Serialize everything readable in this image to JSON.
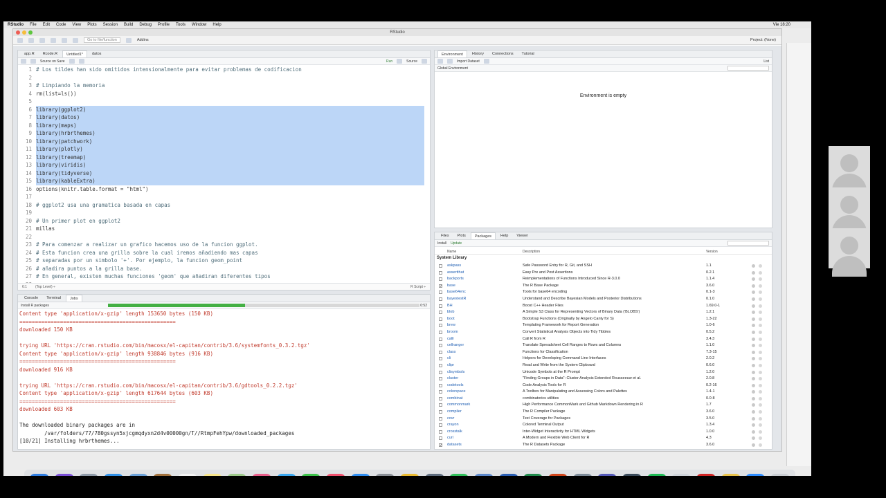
{
  "menubar": {
    "items": [
      "RStudio",
      "File",
      "Edit",
      "Code",
      "View",
      "Plots",
      "Session",
      "Build",
      "Debug",
      "Profile",
      "Tools",
      "Window",
      "Help"
    ],
    "clock": "Vie 18:20"
  },
  "window": {
    "title": "RStudio",
    "toolbar": {
      "goto_placeholder": "Go to file/function",
      "addins": "Addins",
      "project": "Project: (None)"
    }
  },
  "editor": {
    "tabs": [
      "app.R",
      "Rcode.R",
      "Untitled1*",
      "datos"
    ],
    "active_tab": "Untitled1*",
    "source_on_save": "Source on Save",
    "run": "Run",
    "source": "Source",
    "lines": [
      {
        "n": "1",
        "text": "# Los tildes han sido omitidos intensionalmente para evitar problemas de codificacion"
      },
      {
        "n": "2",
        "text": ""
      },
      {
        "n": "3",
        "text": "# Limpiando la memoria"
      },
      {
        "n": "4",
        "text": "rm(list=ls())"
      },
      {
        "n": "5",
        "text": ""
      },
      {
        "n": "6",
        "text": "library(ggplot2)"
      },
      {
        "n": "7",
        "text": "library(datos)"
      },
      {
        "n": "8",
        "text": "library(maps)"
      },
      {
        "n": "9",
        "text": "library(hrbrthemes)"
      },
      {
        "n": "10",
        "text": "library(patchwork)"
      },
      {
        "n": "11",
        "text": "library(plotly)"
      },
      {
        "n": "12",
        "text": "library(treemap)"
      },
      {
        "n": "13",
        "text": "library(viridis)"
      },
      {
        "n": "14",
        "text": "library(tidyverse)"
      },
      {
        "n": "15",
        "text": "library(kableExtra)"
      },
      {
        "n": "16",
        "text": "options(knitr.table.format = \"html\")"
      },
      {
        "n": "17",
        "text": ""
      },
      {
        "n": "18",
        "text": "# ggplot2 usa una gramatica basada en capas"
      },
      {
        "n": "19",
        "text": ""
      },
      {
        "n": "20",
        "text": "# Un primer plot en ggplot2"
      },
      {
        "n": "21",
        "text": "millas"
      },
      {
        "n": "22",
        "text": ""
      },
      {
        "n": "23",
        "text": "# Para comenzar a realizar un grafico hacemos uso de la funcion ggplot."
      },
      {
        "n": "24",
        "text": "# Esta funcion crea una grilla sobre la cual iremos añadiendo mas capas"
      },
      {
        "n": "25",
        "text": "# separadas por un simbolo '+'. Por ejemplo, la funcion geom_point"
      },
      {
        "n": "26",
        "text": "# añadira puntos a la grilla base."
      },
      {
        "n": "27",
        "text": "# En general, existen muchas funciones 'geom' que añadiran diferentes tipos"
      },
      {
        "n": "28",
        "text": ""
      }
    ],
    "status_pos": "6:1",
    "status_level": "(Top Level) ÷",
    "status_lang": "R Script ÷"
  },
  "console": {
    "tabs": [
      "Console",
      "Terminal",
      "Jobs"
    ],
    "job_name": "Install R packages",
    "job_time": "0:52",
    "progress": 0.44,
    "lines": [
      {
        "t": "Content type 'application/x-gzip' length 153650 bytes (150 KB)",
        "c": "red"
      },
      {
        "t": "==================================================",
        "c": "red"
      },
      {
        "t": "downloaded 150 KB",
        "c": "red"
      },
      {
        "t": "",
        "c": "red"
      },
      {
        "t": "trying URL 'https://cran.rstudio.com/bin/macosx/el-capitan/contrib/3.6/systemfonts_0.3.2.tgz'",
        "c": "red"
      },
      {
        "t": "Content type 'application/x-gzip' length 938846 bytes (916 KB)",
        "c": "red"
      },
      {
        "t": "==================================================",
        "c": "red"
      },
      {
        "t": "downloaded 916 KB",
        "c": "red"
      },
      {
        "t": "",
        "c": "red"
      },
      {
        "t": "trying URL 'https://cran.rstudio.com/bin/macosx/el-capitan/contrib/3.6/gdtools_0.2.2.tgz'",
        "c": "red"
      },
      {
        "t": "Content type 'application/x-gzip' length 617644 bytes (603 KB)",
        "c": "red"
      },
      {
        "t": "==================================================",
        "c": "red"
      },
      {
        "t": "downloaded 603 KB",
        "c": "red"
      },
      {
        "t": "",
        "c": "red"
      },
      {
        "t": "The downloaded binary packages are in",
        "c": "plain"
      },
      {
        "t": "        /var/folders/77/780gssyn5xjcgmqdyxn2d4v00000gn/T//RtmpFehYpw/downloaded_packages",
        "c": "plain"
      },
      {
        "t": "[10/21] Installing hrbrthemes...",
        "c": "plain"
      }
    ]
  },
  "environment": {
    "tabs": [
      "Environment",
      "History",
      "Connections",
      "Tutorial"
    ],
    "import_dataset": "Import Dataset",
    "list": "List",
    "global_env": "Global Environment",
    "empty_message": "Environment is empty"
  },
  "packages": {
    "tabs": [
      "Files",
      "Plots",
      "Packages",
      "Help",
      "Viewer"
    ],
    "install": "Install",
    "update": "Update",
    "col_name": "Name",
    "col_desc": "Description",
    "col_version": "Version",
    "section": "System Library",
    "rows": [
      {
        "name": "askpass",
        "desc": "Safe Password Entry for R, Git, and SSH",
        "ver": "1.1",
        "checked": false
      },
      {
        "name": "assertthat",
        "desc": "Easy Pre and Post Assertions",
        "ver": "0.2.1",
        "checked": false
      },
      {
        "name": "backports",
        "desc": "Reimplementations of Functions Introduced Since R-3.0.0",
        "ver": "1.1.4",
        "checked": false
      },
      {
        "name": "base",
        "desc": "The R Base Package",
        "ver": "3.6.0",
        "checked": true
      },
      {
        "name": "base64enc",
        "desc": "Tools for base64 encoding",
        "ver": "0.1-3",
        "checked": false
      },
      {
        "name": "bayestestR",
        "desc": "Understand and Describe Bayesian Models and Posterior Distributions",
        "ver": "0.1.0",
        "checked": false
      },
      {
        "name": "BH",
        "desc": "Boost C++ Header Files",
        "ver": "1.69.0-1",
        "checked": false
      },
      {
        "name": "blob",
        "desc": "A Simple S3 Class for Representing Vectors of Binary Data ('BLOBS')",
        "ver": "1.2.1",
        "checked": false
      },
      {
        "name": "boot",
        "desc": "Bootstrap Functions (Originally by Angelo Canty for S)",
        "ver": "1.3-22",
        "checked": false
      },
      {
        "name": "brew",
        "desc": "Templating Framework for Report Generation",
        "ver": "1.0-6",
        "checked": false
      },
      {
        "name": "broom",
        "desc": "Convert Statistical Analysis Objects into Tidy Tibbles",
        "ver": "0.5.2",
        "checked": false
      },
      {
        "name": "callr",
        "desc": "Call R from R",
        "ver": "3.4.3",
        "checked": false
      },
      {
        "name": "cellranger",
        "desc": "Translate Spreadsheet Cell Ranges to Rows and Columns",
        "ver": "1.1.0",
        "checked": false
      },
      {
        "name": "class",
        "desc": "Functions for Classification",
        "ver": "7.3-15",
        "checked": false
      },
      {
        "name": "cli",
        "desc": "Helpers for Developing Command Line Interfaces",
        "ver": "2.0.2",
        "checked": false
      },
      {
        "name": "clipr",
        "desc": "Read and Write from the System Clipboard",
        "ver": "0.6.0",
        "checked": false
      },
      {
        "name": "clisymbols",
        "desc": "Unicode Symbols at the R Prompt",
        "ver": "1.2.0",
        "checked": false
      },
      {
        "name": "cluster",
        "desc": "\"Finding Groups in Data\": Cluster Analysis Extended Rousseeuw et al.",
        "ver": "2.0.8",
        "checked": false
      },
      {
        "name": "codetools",
        "desc": "Code Analysis Tools for R",
        "ver": "0.2-16",
        "checked": false
      },
      {
        "name": "colorspace",
        "desc": "A Toolbox for Manipulating and Assessing Colors and Palettes",
        "ver": "1.4-1",
        "checked": false
      },
      {
        "name": "combinat",
        "desc": "combinatorics utilities",
        "ver": "0.0-8",
        "checked": false
      },
      {
        "name": "commonmark",
        "desc": "High Performance CommonMark and Github Markdown Rendering in R",
        "ver": "1.7",
        "checked": false
      },
      {
        "name": "compiler",
        "desc": "The R Compiler Package",
        "ver": "3.6.0",
        "checked": false
      },
      {
        "name": "covr",
        "desc": "Test Coverage for Packages",
        "ver": "3.5.0",
        "checked": false
      },
      {
        "name": "crayon",
        "desc": "Colored Terminal Output",
        "ver": "1.3.4",
        "checked": false
      },
      {
        "name": "crosstalk",
        "desc": "Inter-Widget Interactivity for HTML Widgets",
        "ver": "1.0.0",
        "checked": false
      },
      {
        "name": "curl",
        "desc": "A Modern and Flexible Web Client for R",
        "ver": "4.3",
        "checked": false
      },
      {
        "name": "datasets",
        "desc": "The R Datasets Package",
        "ver": "3.6.0",
        "checked": true
      }
    ]
  },
  "dock": {
    "calendar_day": "30",
    "apps": [
      {
        "name": "finder-icon",
        "color": "#2f7de1",
        "glyph": ""
      },
      {
        "name": "siri-icon",
        "color": "#7a4fd6",
        "glyph": ""
      },
      {
        "name": "launchpad-icon",
        "color": "#8e9aa8",
        "glyph": ""
      },
      {
        "name": "safari-icon",
        "color": "#2f8fe6",
        "glyph": ""
      },
      {
        "name": "preview-icon",
        "color": "#6aa0d8",
        "glyph": ""
      },
      {
        "name": "notes-book-icon",
        "color": "#a0703c",
        "glyph": ""
      },
      {
        "name": "calendar-icon",
        "color": "#f4f4f4",
        "glyph": "30"
      },
      {
        "name": "notes-icon",
        "color": "#f7e58a",
        "glyph": ""
      },
      {
        "name": "maps-icon",
        "color": "#9cc98a",
        "glyph": ""
      },
      {
        "name": "photos-icon",
        "color": "#e85d8a",
        "glyph": ""
      },
      {
        "name": "messages-icon",
        "color": "#3aa7f0",
        "glyph": ""
      },
      {
        "name": "facetime-icon",
        "color": "#3cc24a",
        "glyph": ""
      },
      {
        "name": "music-icon",
        "color": "#f0506e",
        "glyph": ""
      },
      {
        "name": "app-store-icon",
        "color": "#2d8cf0",
        "glyph": "A"
      },
      {
        "name": "system-preferences-icon",
        "color": "#8a8f96",
        "glyph": ""
      },
      {
        "name": "chrome-icon",
        "color": "#e9b92f",
        "glyph": ""
      },
      {
        "name": "math-icon",
        "color": "#5d6b7d",
        "glyph": "Σ"
      },
      {
        "name": "whatsapp-icon",
        "color": "#2fbf5a",
        "glyph": ""
      },
      {
        "name": "r-icon",
        "color": "#5a86c9",
        "glyph": "R"
      },
      {
        "name": "word-icon",
        "color": "#2b5fb4",
        "glyph": "W"
      },
      {
        "name": "excel-icon",
        "color": "#1f8a4c",
        "glyph": "X"
      },
      {
        "name": "powerpoint-icon",
        "color": "#d0451b",
        "glyph": "P"
      },
      {
        "name": "image-capture-icon",
        "color": "#7c8a98",
        "glyph": ""
      },
      {
        "name": "teams-icon",
        "color": "#5459b8",
        "glyph": "T"
      },
      {
        "name": "quicktime-icon",
        "color": "#3a4a5a",
        "glyph": "Q"
      },
      {
        "name": "spotify-icon",
        "color": "#1db954",
        "glyph": ""
      },
      {
        "name": "app-icon",
        "color": "#cfd4da",
        "glyph": ""
      },
      {
        "name": "acrobat-icon",
        "color": "#d02525",
        "glyph": ""
      },
      {
        "name": "utility-icon",
        "color": "#e8c24a",
        "glyph": ""
      },
      {
        "name": "zoom-icon",
        "color": "#2d8cff",
        "glyph": ""
      },
      {
        "name": "trash-icon",
        "color": "#c9cdd2",
        "glyph": ""
      }
    ]
  }
}
